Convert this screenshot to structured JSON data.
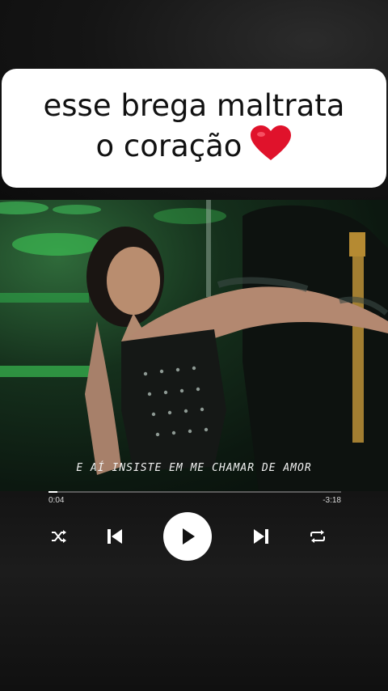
{
  "caption": {
    "line1": "esse brega maltrata",
    "line2": "o coração",
    "emoji": "heart-emoji"
  },
  "video": {
    "lyrics": "E AÍ INSISTE EM ME CHAMAR DE AMOR"
  },
  "player": {
    "elapsed": "0:04",
    "remaining": "-3:18",
    "progress": 0.03,
    "controls": [
      "shuffle-icon",
      "previous-icon",
      "play-icon",
      "next-icon",
      "repeat-icon"
    ]
  },
  "colors": {
    "card": "#ffffff",
    "heart": "#e0122b",
    "stage_green": "#3fd35a"
  }
}
